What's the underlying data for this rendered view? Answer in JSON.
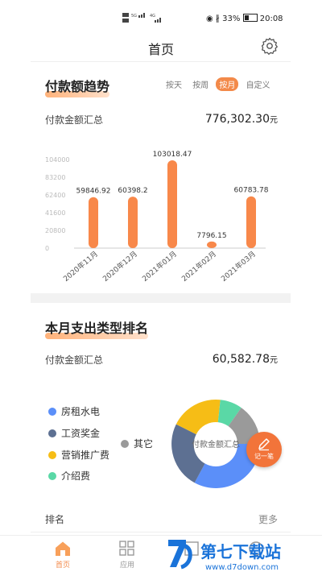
{
  "status": {
    "sim": "HD 5G",
    "battery": "33%",
    "time": "20:08"
  },
  "header": {
    "title": "首页"
  },
  "trend": {
    "title": "付款额趋势",
    "tabs": [
      "按天",
      "按周",
      "按月",
      "自定义"
    ],
    "active_tab": "按月",
    "sum_label": "付款金额汇总",
    "sum_value": "776,302.30",
    "sum_unit": "元"
  },
  "chart_data": {
    "type": "bar",
    "categories": [
      "2020年11月",
      "2020年12月",
      "2021年01月",
      "2021年02月",
      "2021年03月"
    ],
    "values": [
      59846.92,
      60398.2,
      103018.47,
      7796.15,
      60783.78
    ],
    "value_labels": [
      "59846.92",
      "60398.2",
      "103018.47",
      "7796.15",
      "60783.78"
    ],
    "y_ticks": [
      "0",
      "20800",
      "41600",
      "62400",
      "83200",
      "104000"
    ],
    "ylim": [
      0,
      104000
    ],
    "bar_color": "#f8884a",
    "title": "",
    "xlabel": "",
    "ylabel": ""
  },
  "ranking": {
    "title": "本月支出类型排名",
    "sum_label": "付款金额汇总",
    "sum_value": "60,582.78",
    "sum_unit": "元",
    "donut_center": "付款金额汇总",
    "legend": [
      {
        "label": "房租水电",
        "color": "#5b8ff9"
      },
      {
        "label": "工资奖金",
        "color": "#5d7092"
      },
      {
        "label": "营销推广费",
        "color": "#f6bd16"
      },
      {
        "label": "介绍费",
        "color": "#5ad8a6"
      },
      {
        "label": "其它",
        "color": "#9a9a9a"
      }
    ],
    "fab_label": "记一笔",
    "rank_label": "排名",
    "more_label": "更多"
  },
  "nav": {
    "items": [
      "首页",
      "应用",
      "",
      ""
    ]
  },
  "watermark": {
    "brand": "第七下载站",
    "url": "www.d7down.com"
  }
}
